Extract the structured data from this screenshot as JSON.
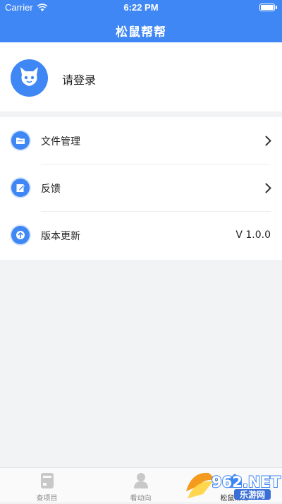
{
  "status_bar": {
    "carrier": "Carrier",
    "time": "6:22 PM"
  },
  "header": {
    "title": "松鼠帮帮"
  },
  "profile": {
    "login_label": "请登录"
  },
  "menu": {
    "items": [
      {
        "label": "文件管理",
        "icon": "folder-icon"
      },
      {
        "label": "反馈",
        "icon": "feedback-icon"
      },
      {
        "label": "版本更新",
        "icon": "upload-icon",
        "value": "V 1.0.0"
      }
    ]
  },
  "tabbar": {
    "tabs": [
      {
        "label": "查项目",
        "icon": "project-icon"
      },
      {
        "label": "看动向",
        "icon": "person-icon"
      },
      {
        "label": "松鼠帮帮",
        "icon": "home-icon",
        "active": true
      }
    ]
  },
  "watermark": {
    "brand": "962.NET",
    "sub": "乐游网"
  },
  "colors": {
    "accent": "#3f87f4",
    "background": "#f2f3f5"
  }
}
